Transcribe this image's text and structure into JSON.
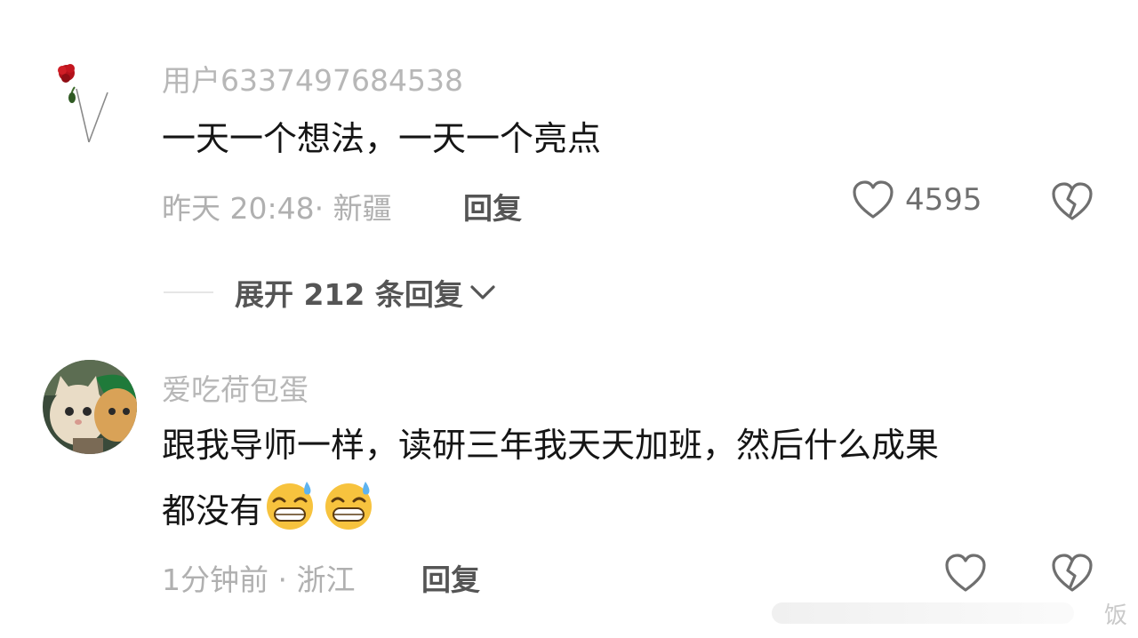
{
  "comments": [
    {
      "username": "用户6337497684538",
      "text_lines": [
        "一天一个想法，一天一个亮点"
      ],
      "time": "昨天 20:48",
      "location": "新疆",
      "meta": "昨天 20:48· 新疆",
      "reply_label": "回复",
      "likes": "4595",
      "avatar_icon": "rose-avatar-icon"
    },
    {
      "username": "爱吃荷包蛋",
      "text_lines": [
        "跟我导师一样，读研三年我天天加班，然后什么成果",
        "都没有"
      ],
      "emoji": [
        "grimacing-sweat-emoji",
        "grimacing-sweat-emoji"
      ],
      "time": "1分钟前",
      "location": "浙江",
      "meta": "1分钟前 · 浙江",
      "reply_label": "回复",
      "likes": "",
      "avatar_icon": "cats-avatar-icon"
    }
  ],
  "expand_replies": {
    "label": "展开 212 条回复",
    "icon": "chevron-down-icon"
  },
  "watermark": "饭",
  "colors": {
    "username": "#b7b7b7",
    "text": "#151515",
    "meta": "#b0b0b0",
    "action": "#555555",
    "icon_stroke": "#6f6f6f"
  }
}
